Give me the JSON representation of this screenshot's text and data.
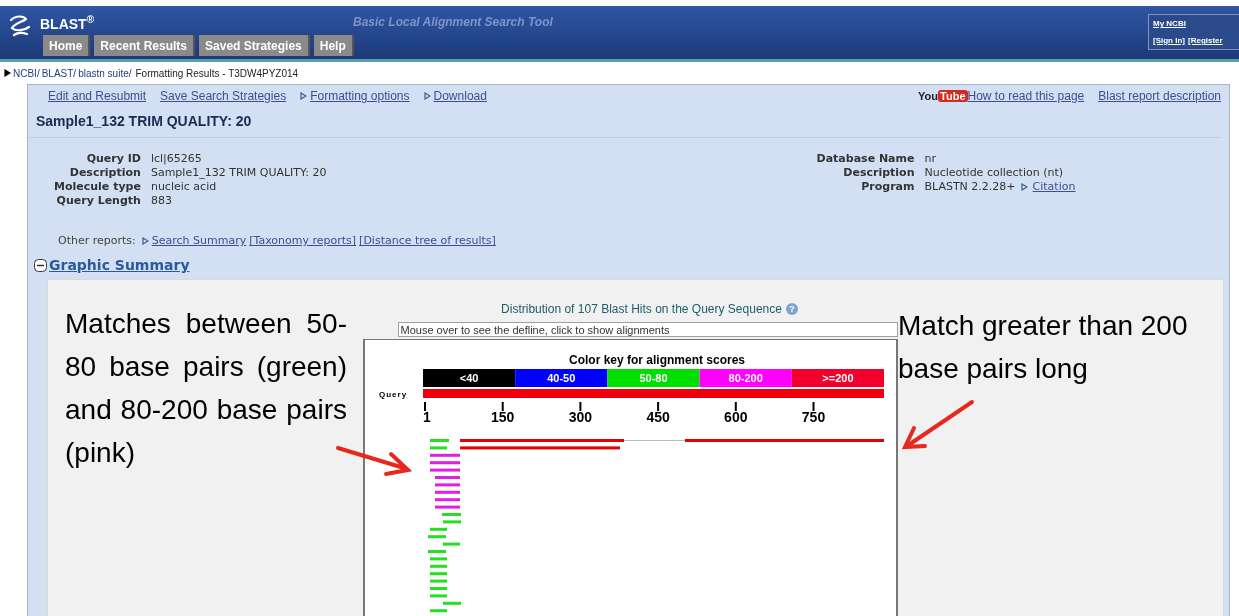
{
  "header": {
    "logo_text": "BLAST",
    "logo_mark": "®",
    "tagline": "Basic Local Alignment Search Tool",
    "tabs": [
      {
        "label": "Home",
        "selected": false
      },
      {
        "label": "Recent Results",
        "selected": false
      },
      {
        "label": "Saved Strategies",
        "selected": false
      },
      {
        "label": "Help",
        "selected": false
      }
    ],
    "account": {
      "title": "My NCBI",
      "links": [
        "[Sign In]",
        "[Register"
      ]
    }
  },
  "breadcrumb": {
    "links": [
      "NCBI/",
      "BLAST/",
      "blastn suite/"
    ],
    "current": "Formatting Results - T3DW4PYZ014"
  },
  "toolbar": {
    "links": [
      {
        "label": "Edit and Resubmit",
        "kind": "plain"
      },
      {
        "label": "Save Search Strategies",
        "kind": "plain"
      },
      {
        "label": "Formatting options",
        "kind": "arrow"
      },
      {
        "label": "Download",
        "kind": "arrow"
      }
    ],
    "video_logo": {
      "left": "You",
      "right": "Tube"
    },
    "right_links": [
      "How to read this page",
      "Blast report description"
    ]
  },
  "title": "Sample1_132 TRIM QUALITY: 20",
  "query_info": [
    {
      "label": "Query ID",
      "value": "lcl|65265"
    },
    {
      "label": "Description",
      "value": "Sample1_132 TRIM QUALITY: 20"
    },
    {
      "label": "Molecule type",
      "value": "nucleic acid"
    },
    {
      "label": "Query Length",
      "value": "883"
    }
  ],
  "database_info": [
    {
      "label": "Database Name",
      "value": "nr"
    },
    {
      "label": "Description",
      "value": "Nucleotide collection (nt)"
    },
    {
      "label": "Program",
      "value": "BLASTN 2.2.28+",
      "link": "Citation"
    }
  ],
  "other_reports": {
    "label": "Other reports:",
    "links": [
      {
        "label": "Search Summary",
        "kind": "arrow"
      },
      {
        "label": "[Taxonomy reports]",
        "kind": "plain"
      },
      {
        "label": "[Distance tree of results]",
        "kind": "plain"
      }
    ]
  },
  "graphic_summary": {
    "heading": "Graphic Summary",
    "expanded": true,
    "chart_title": "Distribution of 107 Blast Hits on the Query Sequence",
    "help_icon": "?",
    "defline_field": "Mouse over to see the defline, click to show alignments",
    "key_title": "Color key for alignment scores",
    "key": [
      {
        "label": "<40",
        "color": "#000000"
      },
      {
        "label": "40-50",
        "color": "#0000ff"
      },
      {
        "label": "50-80",
        "color": "#00e000"
      },
      {
        "label": "80-200",
        "color": "#ff00ff"
      },
      {
        "label": ">=200",
        "color": "#f0002a"
      }
    ],
    "query_label": "Query",
    "ticks": [
      "1",
      "150",
      "300",
      "450",
      "600",
      "750"
    ]
  },
  "annotations": [
    {
      "text": "Matches between 50-80 base pairs (green) and 80-200 base pairs (pink)",
      "kind": "left"
    },
    {
      "text": "Match greater than 200 base pairs long",
      "kind": "right"
    }
  ]
}
